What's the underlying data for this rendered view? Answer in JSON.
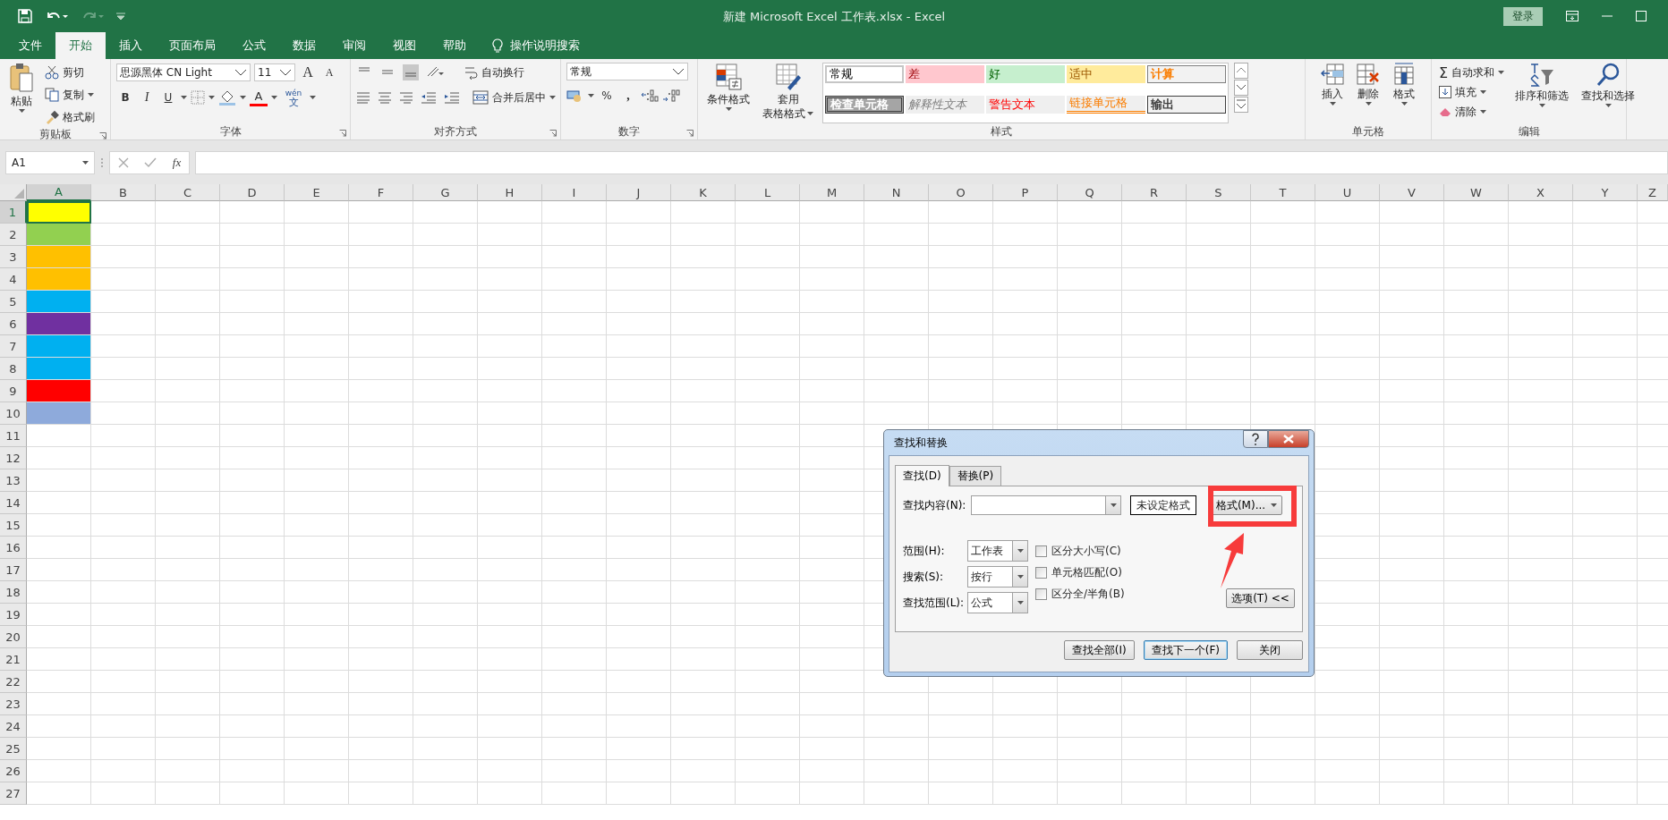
{
  "title_bar": {
    "title": "新建 Microsoft Excel 工作表.xlsx  -  Excel",
    "sign_in": "登录"
  },
  "ribbon_tabs": [
    {
      "label": "文件",
      "selected": false
    },
    {
      "label": "开始",
      "selected": true
    },
    {
      "label": "插入",
      "selected": false
    },
    {
      "label": "页面布局",
      "selected": false
    },
    {
      "label": "公式",
      "selected": false
    },
    {
      "label": "数据",
      "selected": false
    },
    {
      "label": "审阅",
      "selected": false
    },
    {
      "label": "视图",
      "selected": false
    },
    {
      "label": "帮助",
      "selected": false
    }
  ],
  "tell_me": "操作说明搜索",
  "clipboard": {
    "paste": "粘贴",
    "cut": "剪切",
    "copy": "复制",
    "format_painter": "格式刷",
    "group": "剪贴板"
  },
  "font": {
    "name": "思源黑体 CN Light",
    "size": "11",
    "grow": "A",
    "shrink": "A",
    "bold": "B",
    "italic": "I",
    "underline": "U",
    "font_color": "A",
    "phonetic_top": "wén",
    "phonetic_bottom": "文",
    "group": "字体"
  },
  "alignment": {
    "wrap": "自动换行",
    "merge": "合并后居中",
    "group": "对齐方式"
  },
  "number": {
    "format": "常规",
    "percent": "%",
    "comma": ",",
    "group": "数字"
  },
  "styles": {
    "conditional": "条件格式",
    "table_top": "套用",
    "table_bottom": "表格格式",
    "group": "样式",
    "cell_styles": [
      {
        "label": "常规",
        "kind": "normal"
      },
      {
        "label": "差",
        "kind": "bad"
      },
      {
        "label": "好",
        "kind": "good"
      },
      {
        "label": "适中",
        "kind": "neutral"
      },
      {
        "label": "计算",
        "kind": "calculation"
      },
      {
        "label": "检查单元格",
        "kind": "check"
      },
      {
        "label": "解释性文本",
        "kind": "explanatory"
      },
      {
        "label": "警告文本",
        "kind": "warning"
      },
      {
        "label": "链接单元格",
        "kind": "linked"
      },
      {
        "label": "输出",
        "kind": "output"
      }
    ]
  },
  "cells": {
    "group": "单元格",
    "items": [
      {
        "label": "插入",
        "kind": "insert"
      },
      {
        "label": "删除",
        "kind": "delete"
      },
      {
        "label": "格式",
        "kind": "format"
      }
    ]
  },
  "editing": {
    "autosum_symbol": "Σ",
    "autosum": "自动求和",
    "fill": "填充",
    "clear": "清除",
    "sort": "排序和筛选",
    "find": "查找和选择",
    "group": "编辑"
  },
  "formula_bar": {
    "name_box": "A1",
    "fx": "fx"
  },
  "sheet": {
    "columns": [
      {
        "label": "A",
        "selected": true
      },
      {
        "label": "B",
        "selected": false
      },
      {
        "label": "C",
        "selected": false
      },
      {
        "label": "D",
        "selected": false
      },
      {
        "label": "E",
        "selected": false
      },
      {
        "label": "F",
        "selected": false
      },
      {
        "label": "G",
        "selected": false
      },
      {
        "label": "H",
        "selected": false
      },
      {
        "label": "I",
        "selected": false
      },
      {
        "label": "J",
        "selected": false
      },
      {
        "label": "K",
        "selected": false
      },
      {
        "label": "L",
        "selected": false
      },
      {
        "label": "M",
        "selected": false
      },
      {
        "label": "N",
        "selected": false
      },
      {
        "label": "O",
        "selected": false
      },
      {
        "label": "P",
        "selected": false
      },
      {
        "label": "Q",
        "selected": false
      },
      {
        "label": "R",
        "selected": false
      },
      {
        "label": "S",
        "selected": false
      },
      {
        "label": "T",
        "selected": false
      },
      {
        "label": "U",
        "selected": false
      },
      {
        "label": "V",
        "selected": false
      },
      {
        "label": "W",
        "selected": false
      },
      {
        "label": "X",
        "selected": false
      },
      {
        "label": "Y",
        "selected": false
      },
      {
        "label": "Z",
        "selected": false
      }
    ],
    "rows": [
      {
        "label": "1",
        "selected": true,
        "color": "#ffff00"
      },
      {
        "label": "2",
        "selected": false,
        "color": "#92d050"
      },
      {
        "label": "3",
        "selected": false,
        "color": "#ffc000"
      },
      {
        "label": "4",
        "selected": false,
        "color": "#ffc000"
      },
      {
        "label": "5",
        "selected": false,
        "color": "#00b0f0"
      },
      {
        "label": "6",
        "selected": false,
        "color": "#7030a0"
      },
      {
        "label": "7",
        "selected": false,
        "color": "#00b0f0"
      },
      {
        "label": "8",
        "selected": false,
        "color": "#00b0f0"
      },
      {
        "label": "9",
        "selected": false,
        "color": "#ff0000"
      },
      {
        "label": "10",
        "selected": false,
        "color": "#8eaadb"
      },
      {
        "label": "11",
        "selected": false
      },
      {
        "label": "12",
        "selected": false
      },
      {
        "label": "13",
        "selected": false
      },
      {
        "label": "14",
        "selected": false
      },
      {
        "label": "15",
        "selected": false
      },
      {
        "label": "16",
        "selected": false
      },
      {
        "label": "17",
        "selected": false
      },
      {
        "label": "18",
        "selected": false
      },
      {
        "label": "19",
        "selected": false
      },
      {
        "label": "20",
        "selected": false
      },
      {
        "label": "21",
        "selected": false
      },
      {
        "label": "22",
        "selected": false
      },
      {
        "label": "23",
        "selected": false
      },
      {
        "label": "24",
        "selected": false
      },
      {
        "label": "25",
        "selected": false
      },
      {
        "label": "26",
        "selected": false
      },
      {
        "label": "27",
        "selected": false
      }
    ]
  },
  "dialog": {
    "title": "查找和替换",
    "tabs": [
      {
        "label": "查找(D)",
        "selected": true
      },
      {
        "label": "替换(P)",
        "selected": false
      }
    ],
    "find_label": "查找内容(N):",
    "format_preview": "未设定格式",
    "format_button": "格式(M)...",
    "options": [
      {
        "label": "范围(H):",
        "value": "工作表"
      },
      {
        "label": "搜索(S):",
        "value": "按行"
      },
      {
        "label": "查找范围(L):",
        "value": "公式"
      }
    ],
    "checkboxes": [
      {
        "label": "区分大小写(C)",
        "checked": false
      },
      {
        "label": "单元格匹配(O)",
        "checked": false
      },
      {
        "label": "区分全/半角(B)",
        "checked": false
      }
    ],
    "options_button": "选项(T) <<",
    "buttons": [
      {
        "label": "查找全部(I)",
        "kind": "normal"
      },
      {
        "label": "查找下一个(F)",
        "kind": "focused"
      },
      {
        "label": "关闭",
        "kind": "normal"
      }
    ]
  }
}
